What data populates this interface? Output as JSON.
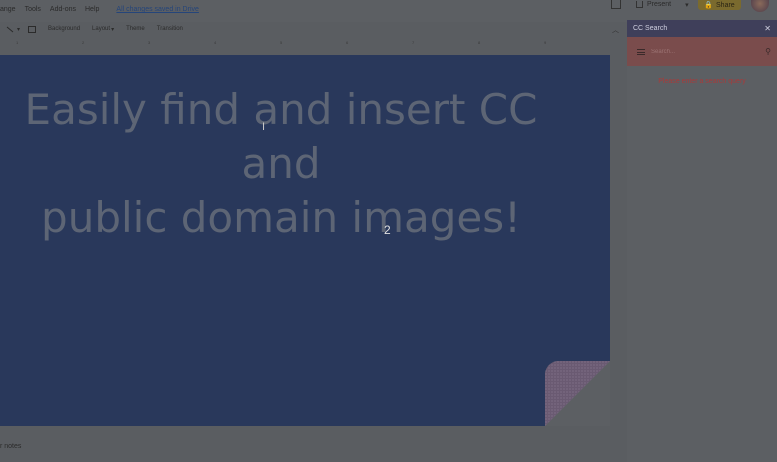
{
  "menubar": {
    "items": [
      "ange",
      "Tools",
      "Add-ons",
      "Help"
    ],
    "save_status": "All changes saved in Drive"
  },
  "header": {
    "present_label": "Present",
    "share_label": "Share"
  },
  "toolbar": {
    "background_label": "Background",
    "layout_label": "Layout",
    "theme_label": "Theme",
    "transition_label": "Transition"
  },
  "ruler": {
    "ticks": [
      "1",
      "2",
      "3",
      "4",
      "5",
      "6",
      "7",
      "8",
      "9"
    ]
  },
  "slide": {
    "title_line1": "Easily find and insert CC and",
    "title_line2": "public domain images!",
    "slide_number": "2",
    "background_color": "#29385b"
  },
  "notes": {
    "label": "r notes"
  },
  "sidebar_panel": {
    "title": "CC Search",
    "close_glyph": "✕",
    "search_placeholder": "Search...",
    "error_message": "Please enter a search query"
  },
  "icons": {
    "menu": "hamburger-icon",
    "search": "search-icon",
    "close": "close-icon"
  }
}
